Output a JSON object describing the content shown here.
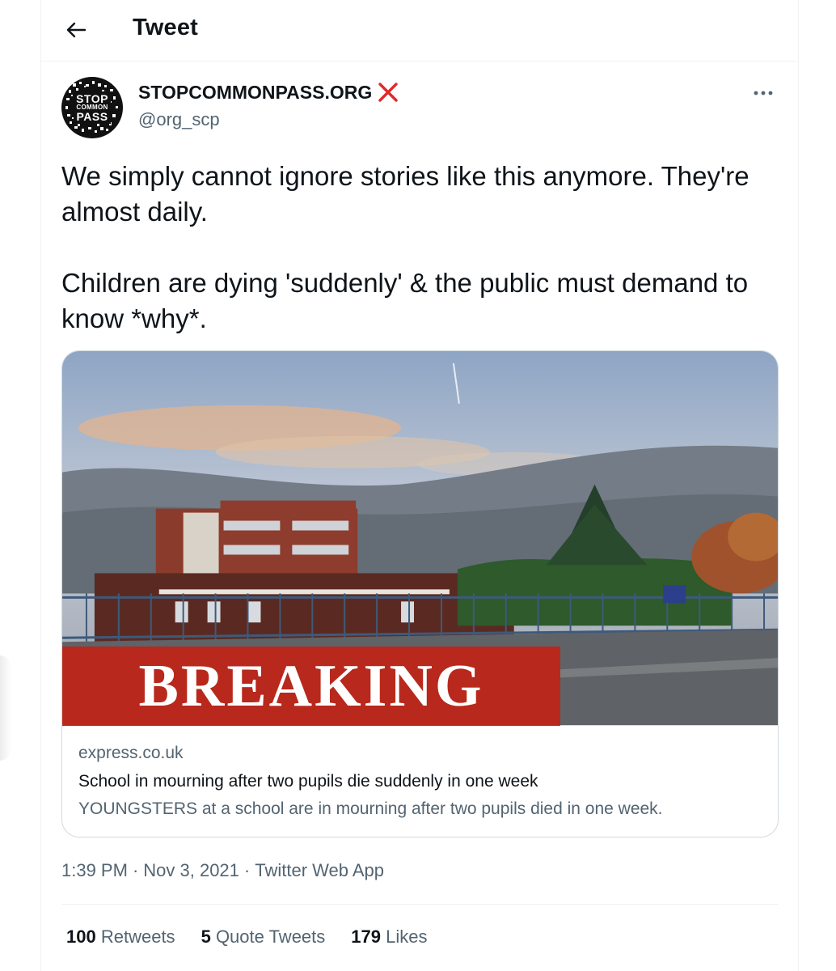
{
  "header": {
    "back_icon": "arrow-left-icon",
    "title": "Tweet"
  },
  "author": {
    "display_name": "STOPCOMMONPASS.ORG",
    "badge_icon": "red-x-icon",
    "badge_color": "#e0292b",
    "handle": "@org_scp",
    "avatar_text": [
      "STOP",
      "COMMON",
      "PASS"
    ]
  },
  "more_icon": "more-horizontal-icon",
  "tweet": {
    "paragraphs": [
      "We simply cannot ignore stories like this anymore. They're almost daily.",
      "Children are dying 'suddenly' & the public must demand to know *why*."
    ]
  },
  "card": {
    "image_banner": "BREAKING",
    "banner_color": "#b8281c",
    "domain": "express.co.uk",
    "title": "School in mourning after two pupils die suddenly in one week",
    "description": "YOUNGSTERS at a school are in mourning after two pupils died in one week."
  },
  "meta": {
    "time": "1:39 PM",
    "separator": "·",
    "date": "Nov 3, 2021",
    "source": "Twitter Web App"
  },
  "stats": [
    {
      "count": "100",
      "label": "Retweets"
    },
    {
      "count": "5",
      "label": "Quote Tweets"
    },
    {
      "count": "179",
      "label": "Likes"
    }
  ]
}
